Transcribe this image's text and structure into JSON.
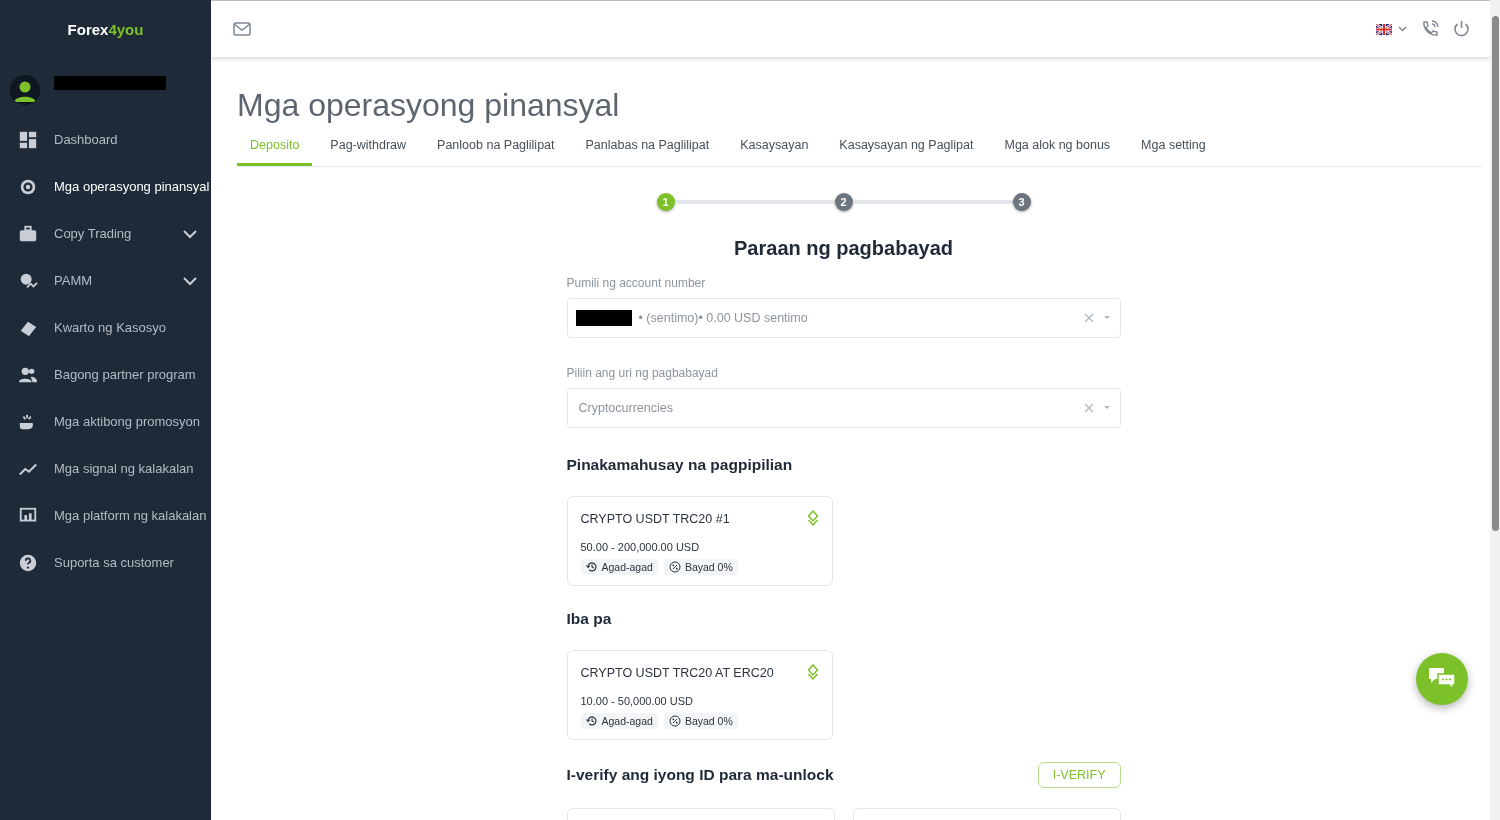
{
  "sidebar": {
    "logo": {
      "text": "Forex",
      "accent": "4you"
    },
    "items": [
      {
        "label": "Dashboard",
        "selected": false,
        "expandable": false
      },
      {
        "label": "Mga operasyong pinansyal",
        "selected": true,
        "expandable": false
      },
      {
        "label": "Copy Trading",
        "selected": false,
        "expandable": true
      },
      {
        "label": "PAMM",
        "selected": false,
        "expandable": true
      },
      {
        "label": "Kwarto ng Kasosyo",
        "selected": false,
        "expandable": false
      },
      {
        "label": "Bagong partner program",
        "selected": false,
        "expandable": false
      },
      {
        "label": "Mga aktibong promosyon",
        "selected": false,
        "expandable": false
      },
      {
        "label": "Mga signal ng kalakalan",
        "selected": false,
        "expandable": false
      },
      {
        "label": "Mga platform ng kalakalan",
        "selected": false,
        "expandable": false
      },
      {
        "label": "Suporta sa customer",
        "selected": false,
        "expandable": false
      }
    ]
  },
  "page_title": "Mga operasyong pinansyal",
  "tabs": [
    {
      "label": "Deposito",
      "selected": true
    },
    {
      "label": "Pag-withdraw",
      "selected": false
    },
    {
      "label": "Panloob na Paglilipat",
      "selected": false
    },
    {
      "label": "Panlabas na Paglilipat",
      "selected": false
    },
    {
      "label": "Kasaysayan",
      "selected": false
    },
    {
      "label": "Kasaysayan ng Paglipat",
      "selected": false
    },
    {
      "label": "Mga alok ng bonus",
      "selected": false
    },
    {
      "label": "Mga setting",
      "selected": false
    }
  ],
  "steps": [
    {
      "label": "1",
      "selected": true
    },
    {
      "label": "2",
      "selected": false
    },
    {
      "label": "3",
      "selected": false
    }
  ],
  "heading": "Paraan ng pagbabayad",
  "fields": [
    {
      "label": "Pumili ng account number",
      "value": "• (sentimo)• 0.00 USD sentimo",
      "redacted": true
    },
    {
      "label": "Piliin ang uri ng pagbabayad",
      "value": "Cryptocurrencies",
      "redacted": false
    }
  ],
  "sections": [
    {
      "title": "Pinakamahusay na pagpipilian",
      "methods": [
        {
          "name": "CRYPTO USDT TRC20 #1",
          "range": "50.00 - 200,000.00 USD",
          "speed": "Agad-agad",
          "fee": "Bayad 0%"
        }
      ]
    },
    {
      "title": "Iba pa",
      "methods": [
        {
          "name": "CRYPTO USDT TRC20 AT ERC20",
          "range": "10.00 - 50,000.00 USD",
          "speed": "Agad-agad",
          "fee": "Bayad 0%"
        }
      ]
    }
  ],
  "verify": {
    "title": "I-verify ang iyong ID para ma-unlock",
    "button": "I-VERIFY"
  }
}
